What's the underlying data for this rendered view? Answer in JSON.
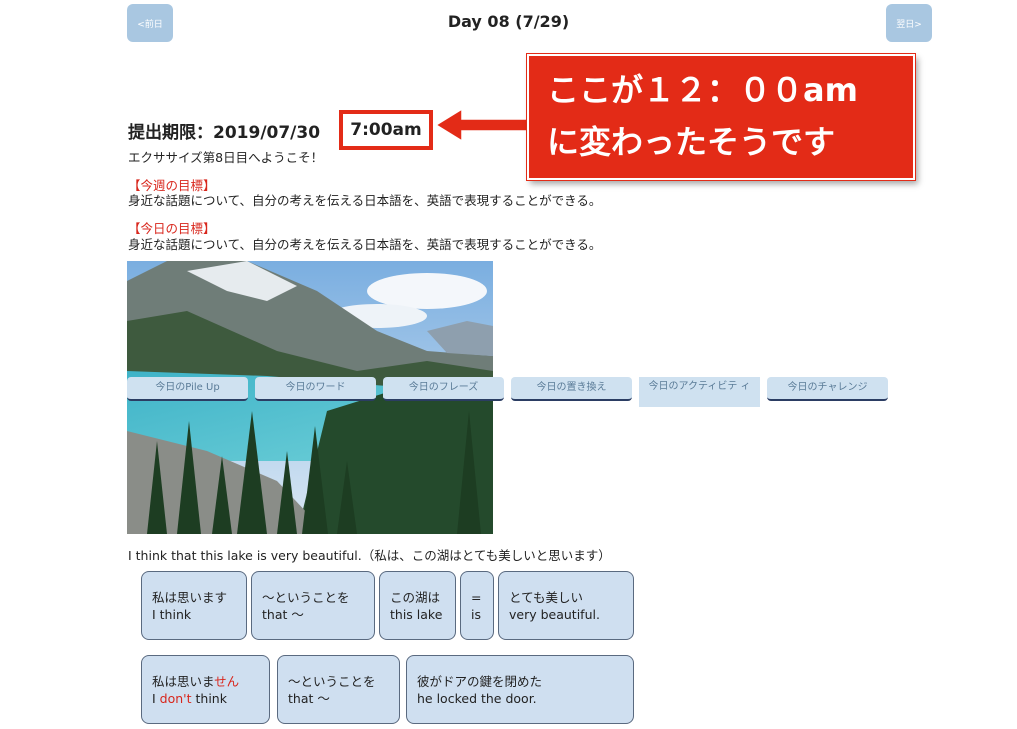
{
  "header": {
    "prev_label": "<前日",
    "next_label": "翌日>",
    "title": "Day 08 (7/29)"
  },
  "deadline": {
    "label": "提出期限：2019/07/30",
    "time": "7:00am"
  },
  "callout": {
    "line1": "ここが１２：００am",
    "line2": "に変わったそうです"
  },
  "intro": {
    "welcome": "エクササイズ第8日目へようこそ！",
    "weekly_goal_heading": "【今週の目標】",
    "weekly_goal": "身近な話題について、自分の考えを伝える日本語を、英語で表現することができる。",
    "daily_goal_heading": "【今日の目標】",
    "daily_goal": "身近な話題について、自分の考えを伝える日本語を、英語で表現することができる。"
  },
  "tabs": [
    {
      "label": "今日のPile Up"
    },
    {
      "label": "今日のワード"
    },
    {
      "label": "今日のフレーズ"
    },
    {
      "label": "今日の置き換え"
    },
    {
      "label": "今日のアクティビテ ィ"
    },
    {
      "label": "今日のチャレンジ"
    }
  ],
  "example_sentence": "I think that this lake is very beautiful.（私は、この湖はとても美しいと思います）",
  "cards_row1": [
    {
      "jp": "私は思います",
      "en": "I think"
    },
    {
      "jp": "〜ということを",
      "en": "that 〜"
    },
    {
      "jp": "この湖は",
      "en": "this lake"
    },
    {
      "jp": "=",
      "en": "is"
    },
    {
      "jp": "とても美しい",
      "en": "very beautiful."
    }
  ],
  "cards_row2": [
    {
      "jp_a": "私は思いま",
      "jp_b": "せん",
      "en_a": "I ",
      "en_b": "don't",
      "en_c": " think"
    },
    {
      "jp": "〜ということを",
      "en": "that 〜"
    },
    {
      "jp": "彼がドアの鍵を閉めた",
      "en": "he locked the door."
    }
  ],
  "colors": {
    "accent_red": "#e32b17",
    "nav_blue": "#a9c7e1",
    "card_blue": "#cfdff0"
  }
}
